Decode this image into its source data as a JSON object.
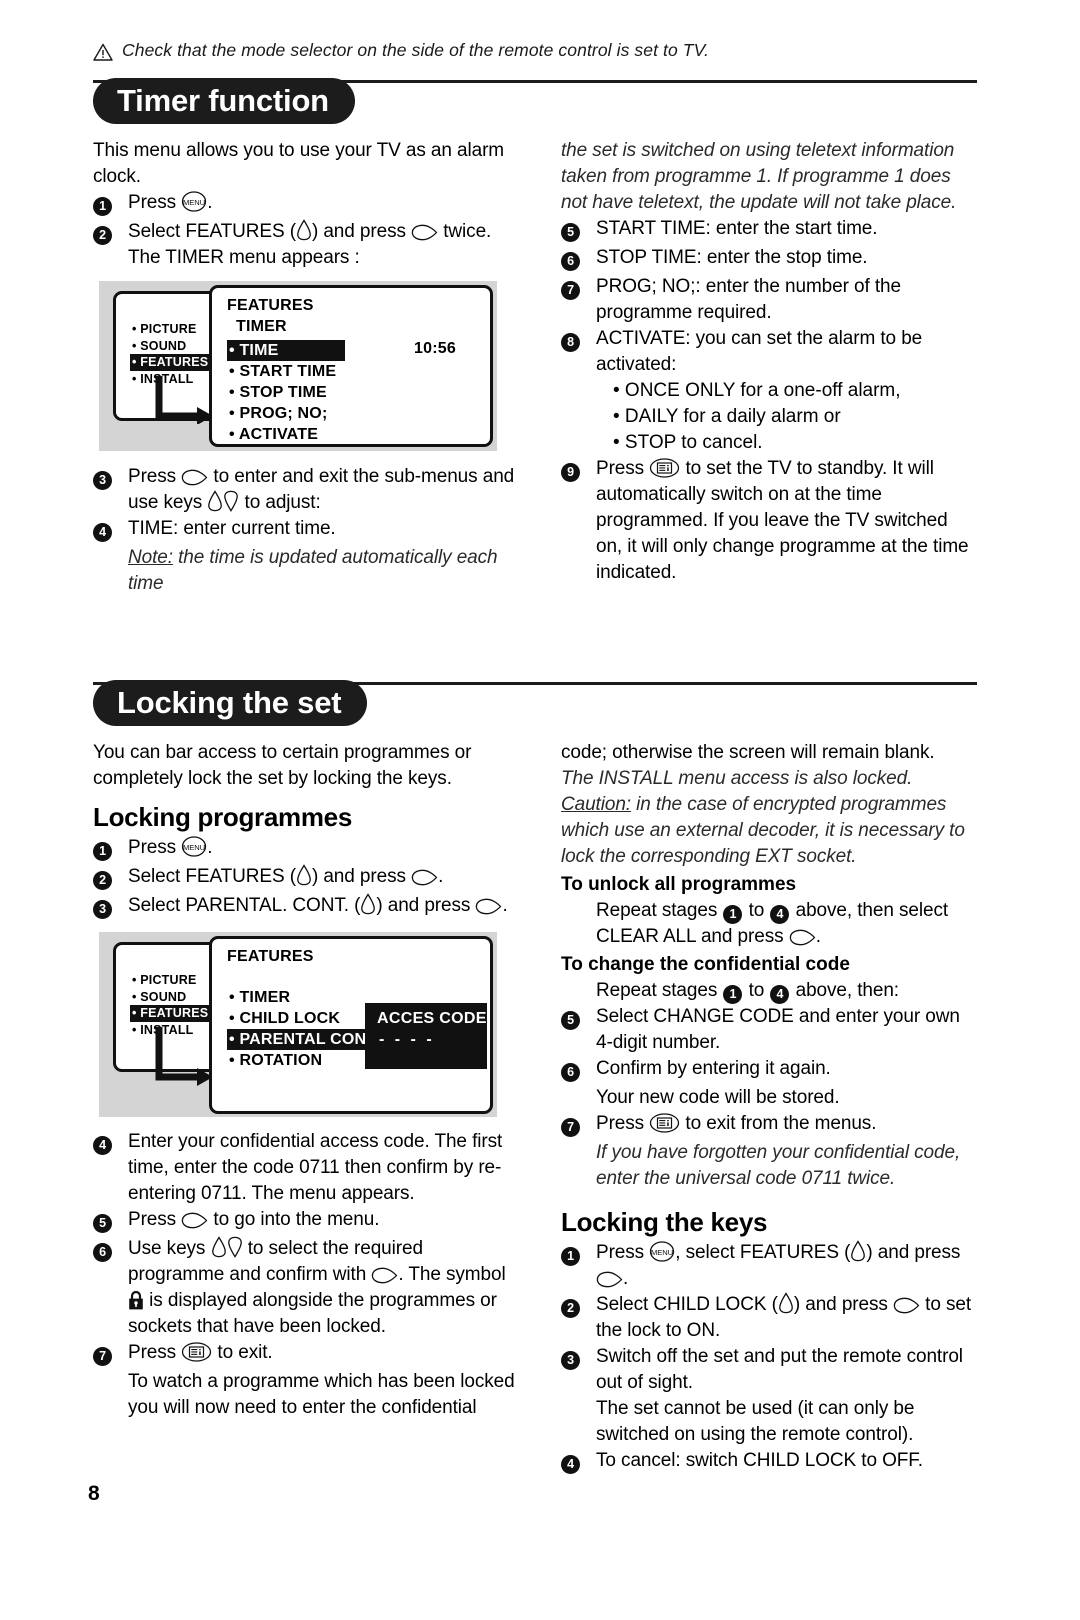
{
  "top_note": {
    "icon": "warning-triangle-icon",
    "text": "Check that the mode selector on the side of the remote control is set to TV."
  },
  "page_number": "8",
  "sections": [
    {
      "id": "timer-function",
      "title": "Timer function",
      "left": {
        "intro": "This menu allows you to use your TV as an alarm clock.",
        "steps": [
          {
            "num": "1",
            "text_parts": [
              "Press ",
              "MENU-icon",
              "."
            ]
          },
          {
            "num": "2",
            "text": "Select FEATURES ( up-down-key-icon ) and press  right-key-icon  twice. The TIMER menu appears :"
          }
        ],
        "steps_after": [
          {
            "num": "3",
            "text": "Press  right-key-icon  to enter and exit the sub-menus and use keys  up-down-keys-icon  to adjust:"
          },
          {
            "num": "4",
            "text": "TIME: enter current time."
          }
        ],
        "note_label": "Note:",
        "note_text": "the time is updated automatically each time"
      },
      "right": {
        "note_continued": "the set is switched on using teletext information taken from programme 1. If programme 1 does not have teletext, the update will not take place.",
        "steps": [
          {
            "num": "5",
            "text": "START TIME: enter the start time."
          },
          {
            "num": "6",
            "text": "STOP TIME: enter the stop time."
          },
          {
            "num": "7",
            "text": "PROG; NO;: enter the number of the programme required."
          },
          {
            "num": "8",
            "text": "ACTIVATE: you can set the alarm to be activated:"
          }
        ],
        "bullets": [
          "• ONCE ONLY for a one-off alarm,",
          "• DAILY for a daily alarm or",
          "• STOP to cancel."
        ],
        "final_step": {
          "num": "9",
          "text_before": "Press ",
          "icon": "exit-menu-icon",
          "text_after": " to set the TV to standby. It will automatically switch on at the time programmed. If you leave the TV switched on, it will only change programme at the time indicated."
        }
      },
      "figure": {
        "name": "tv-menu-timer-screenshot",
        "left_menu": [
          "PICTURE",
          "SOUND",
          "FEATURES",
          "INSTALL"
        ],
        "left_menu_selected": "FEATURES",
        "right_title": "FEATURES",
        "right_subtitle": "TIMER",
        "right_items": [
          "TIME",
          "START TIME",
          "STOP TIME",
          "PROG; NO;",
          "ACTIVATE"
        ],
        "right_selected": "TIME",
        "time_value": "10:56"
      }
    },
    {
      "id": "locking-the-set",
      "title": "Locking the set",
      "left": {
        "intro": "You can bar access to certain programmes or completely lock the set by locking the keys.",
        "sub_head": "Locking programmes",
        "steps": [
          {
            "num": "1",
            "text": "Press MENU-icon ."
          },
          {
            "num": "2",
            "text": "Select FEATURES ( up-down-key-icon ) and press right-key-icon ."
          },
          {
            "num": "3",
            "text": "Select PARENTAL. CONT. ( up-down-key-icon ) and press right-key-icon ."
          }
        ],
        "steps_after": [
          {
            "num": "4",
            "text": "Enter your confidential access code. The first time, enter the code 0711 then confirm by re-entering 0711. The menu appears."
          },
          {
            "num": "5",
            "text": "Press  right-key-icon  to go into the menu."
          },
          {
            "num": "6",
            "text": "Use keys  up-down-keys-icon  to select the required programme and confirm with  right-key-icon . The symbol  lock-icon  is displayed alongside the programmes or sockets that have been locked."
          },
          {
            "num": "7",
            "text": "Press  exit-menu-icon  to exit."
          }
        ],
        "tail": "To watch a programme which has been locked you will now need to enter the confidential"
      },
      "right": {
        "tail_continued": "code; otherwise the screen will remain blank.",
        "italic_lines": [
          "The INSTALL menu access is also locked.",
          "Caution: in the case of encrypted programmes which use an external decoder, it is necessary to lock the corresponding EXT socket."
        ],
        "caution_label": "Caution:",
        "unlock_head": "To unlock all programmes",
        "unlock_text": "Repeat stages  1  to  4  above, then select CLEAR ALL and press  right-key-icon .",
        "change_head": "To change the confidential code",
        "change_text": "Repeat stages  1  to  4  above, then:",
        "change_steps": [
          {
            "num": "5",
            "text": "Select CHANGE CODE and enter your own 4-digit number."
          },
          {
            "num": "6",
            "text": "Confirm by entering it again."
          }
        ],
        "change_note": "Your new code will be stored.",
        "change_exit": {
          "num": "7",
          "text": "Press  exit-menu-icon  to exit from the menus."
        },
        "forgotten_note": "If you have forgotten your confidential code, enter the universal code 0711 twice.",
        "keys_head": "Locking the keys",
        "keys_steps": [
          {
            "num": "1",
            "text": "Press MENU-icon , select FEATURES ( up-down-key-icon ) and press right-key-icon ."
          },
          {
            "num": "2",
            "text": "Select CHILD LOCK ( up-down-key-icon ) and press  right-key-icon  to set the lock to ON."
          },
          {
            "num": "3",
            "text": "Switch off the set and put the remote control out of sight."
          }
        ],
        "keys_note": "The set cannot be used (it can only be switched on using the remote control).",
        "keys_final": {
          "num": "4",
          "text": "To cancel: switch CHILD LOCK to OFF."
        }
      },
      "figure": {
        "name": "tv-menu-parental-screenshot",
        "left_menu": [
          "PICTURE",
          "SOUND",
          "FEATURES",
          "INSTALL"
        ],
        "left_menu_selected": "FEATURES",
        "right_title": "FEATURES",
        "right_items": [
          "TIMER",
          "CHILD LOCK",
          "PARENTAL CONT",
          "ROTATION"
        ],
        "right_selected": "PARENTAL CONT",
        "code_box_title": "ACCES CODE",
        "code_box_value": "- - - -"
      }
    }
  ],
  "colors": {
    "ink": "#1c1c1c",
    "figure_bg": "#d4d4d4",
    "highlight": "#111111"
  }
}
